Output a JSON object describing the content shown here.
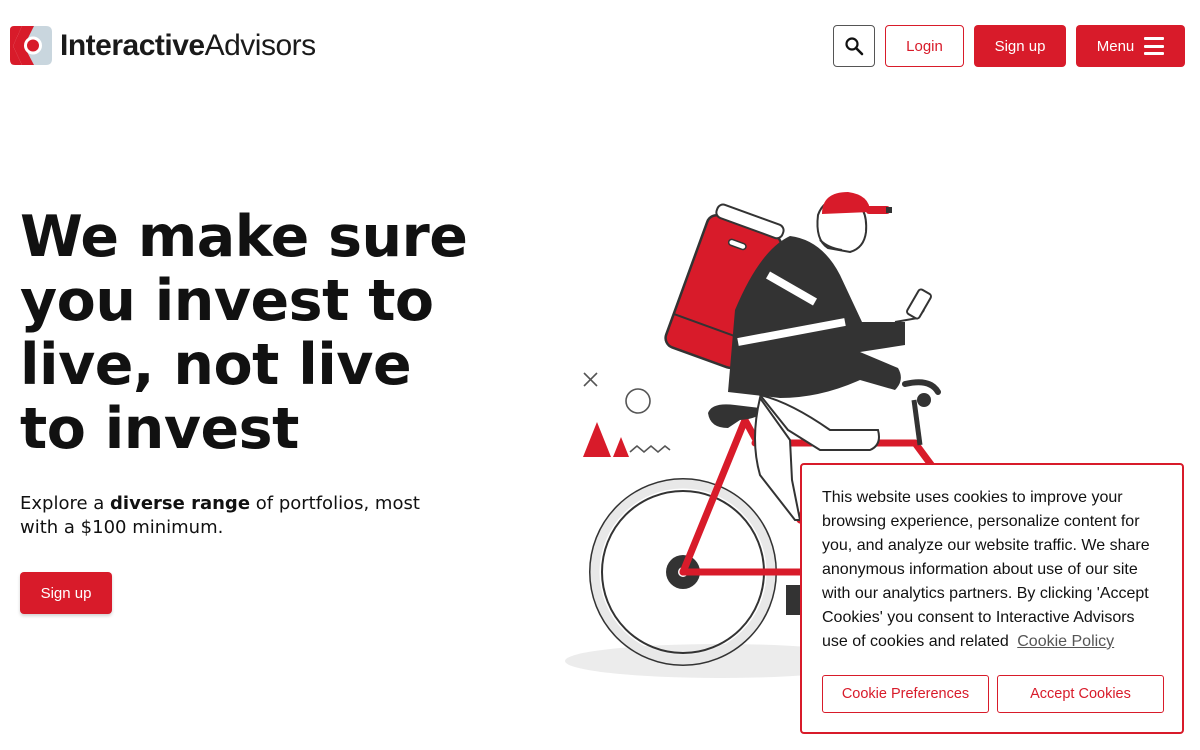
{
  "header": {
    "logo_bold": "Interactive",
    "logo_regular": "Advisors",
    "search_icon": "search-icon",
    "login_label": "Login",
    "signup_label": "Sign up",
    "menu_label": "Menu",
    "menu_icon": "hamburger-icon"
  },
  "hero": {
    "title": "We make sure you invest to live, not live to invest",
    "subtitle_pre": "Explore a ",
    "subtitle_bold": "diverse range",
    "subtitle_post": " of portfolios, most with a $100 minimum.",
    "cta_label": "Sign up"
  },
  "illustration": {
    "subject": "delivery-cyclist-illustration"
  },
  "cookie_banner": {
    "text": "This website uses cookies to improve your browsing experience, personalize content for you, and analyze our website traffic. We share anonymous information about use of our site with our analytics partners. By clicking 'Accept Cookies' you consent to Interactive Advisors use of cookies and related",
    "policy_link": "Cookie Policy",
    "preferences_label": "Cookie Preferences",
    "accept_label": "Accept Cookies"
  },
  "colors": {
    "brand_red": "#d81b2a",
    "text_dark": "#111111",
    "illustration_dark": "#333333"
  }
}
